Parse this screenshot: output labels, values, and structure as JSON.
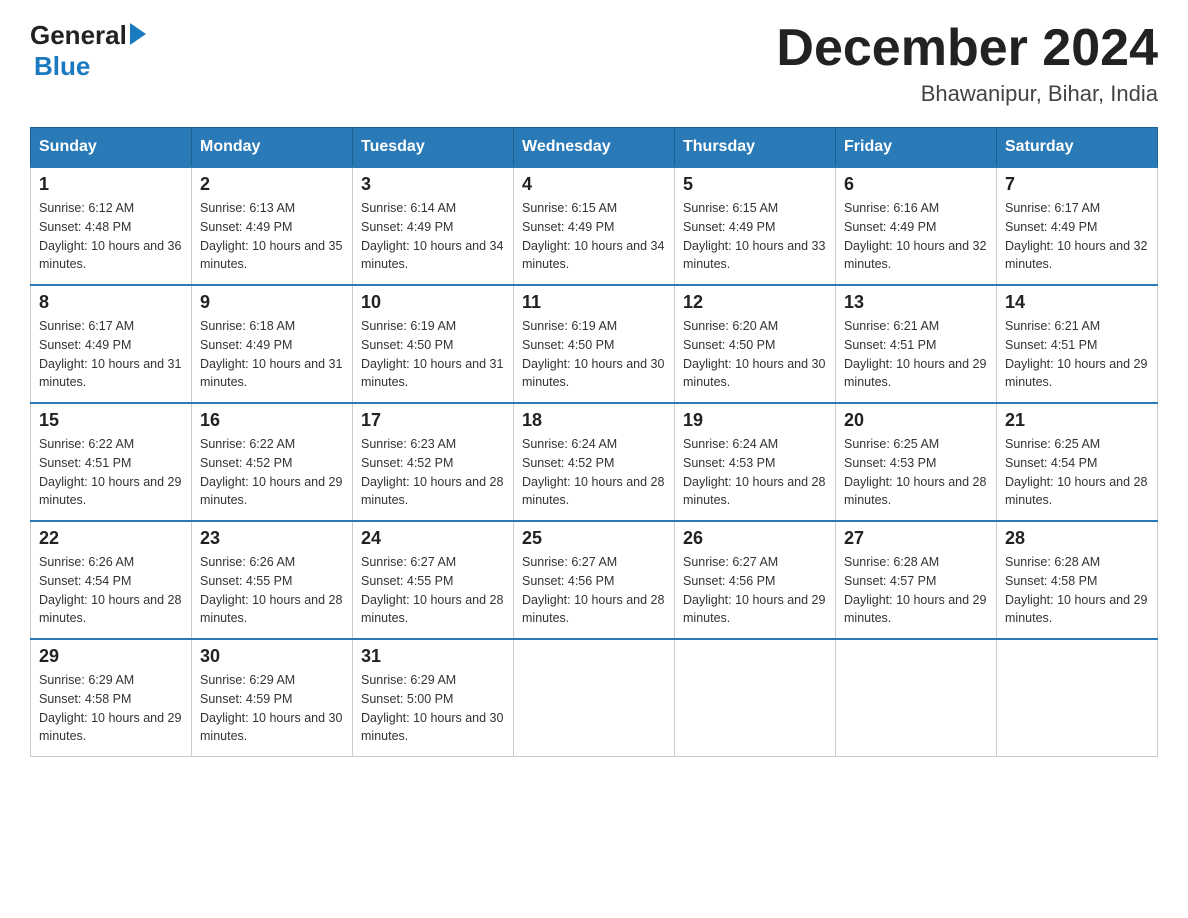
{
  "header": {
    "logo_general": "General",
    "logo_blue": "Blue",
    "month_title": "December 2024",
    "location": "Bhawanipur, Bihar, India"
  },
  "weekdays": [
    "Sunday",
    "Monday",
    "Tuesday",
    "Wednesday",
    "Thursday",
    "Friday",
    "Saturday"
  ],
  "weeks": [
    {
      "days": [
        {
          "number": "1",
          "sunrise": "Sunrise: 6:12 AM",
          "sunset": "Sunset: 4:48 PM",
          "daylight": "Daylight: 10 hours and 36 minutes."
        },
        {
          "number": "2",
          "sunrise": "Sunrise: 6:13 AM",
          "sunset": "Sunset: 4:49 PM",
          "daylight": "Daylight: 10 hours and 35 minutes."
        },
        {
          "number": "3",
          "sunrise": "Sunrise: 6:14 AM",
          "sunset": "Sunset: 4:49 PM",
          "daylight": "Daylight: 10 hours and 34 minutes."
        },
        {
          "number": "4",
          "sunrise": "Sunrise: 6:15 AM",
          "sunset": "Sunset: 4:49 PM",
          "daylight": "Daylight: 10 hours and 34 minutes."
        },
        {
          "number": "5",
          "sunrise": "Sunrise: 6:15 AM",
          "sunset": "Sunset: 4:49 PM",
          "daylight": "Daylight: 10 hours and 33 minutes."
        },
        {
          "number": "6",
          "sunrise": "Sunrise: 6:16 AM",
          "sunset": "Sunset: 4:49 PM",
          "daylight": "Daylight: 10 hours and 32 minutes."
        },
        {
          "number": "7",
          "sunrise": "Sunrise: 6:17 AM",
          "sunset": "Sunset: 4:49 PM",
          "daylight": "Daylight: 10 hours and 32 minutes."
        }
      ]
    },
    {
      "days": [
        {
          "number": "8",
          "sunrise": "Sunrise: 6:17 AM",
          "sunset": "Sunset: 4:49 PM",
          "daylight": "Daylight: 10 hours and 31 minutes."
        },
        {
          "number": "9",
          "sunrise": "Sunrise: 6:18 AM",
          "sunset": "Sunset: 4:49 PM",
          "daylight": "Daylight: 10 hours and 31 minutes."
        },
        {
          "number": "10",
          "sunrise": "Sunrise: 6:19 AM",
          "sunset": "Sunset: 4:50 PM",
          "daylight": "Daylight: 10 hours and 31 minutes."
        },
        {
          "number": "11",
          "sunrise": "Sunrise: 6:19 AM",
          "sunset": "Sunset: 4:50 PM",
          "daylight": "Daylight: 10 hours and 30 minutes."
        },
        {
          "number": "12",
          "sunrise": "Sunrise: 6:20 AM",
          "sunset": "Sunset: 4:50 PM",
          "daylight": "Daylight: 10 hours and 30 minutes."
        },
        {
          "number": "13",
          "sunrise": "Sunrise: 6:21 AM",
          "sunset": "Sunset: 4:51 PM",
          "daylight": "Daylight: 10 hours and 29 minutes."
        },
        {
          "number": "14",
          "sunrise": "Sunrise: 6:21 AM",
          "sunset": "Sunset: 4:51 PM",
          "daylight": "Daylight: 10 hours and 29 minutes."
        }
      ]
    },
    {
      "days": [
        {
          "number": "15",
          "sunrise": "Sunrise: 6:22 AM",
          "sunset": "Sunset: 4:51 PM",
          "daylight": "Daylight: 10 hours and 29 minutes."
        },
        {
          "number": "16",
          "sunrise": "Sunrise: 6:22 AM",
          "sunset": "Sunset: 4:52 PM",
          "daylight": "Daylight: 10 hours and 29 minutes."
        },
        {
          "number": "17",
          "sunrise": "Sunrise: 6:23 AM",
          "sunset": "Sunset: 4:52 PM",
          "daylight": "Daylight: 10 hours and 28 minutes."
        },
        {
          "number": "18",
          "sunrise": "Sunrise: 6:24 AM",
          "sunset": "Sunset: 4:52 PM",
          "daylight": "Daylight: 10 hours and 28 minutes."
        },
        {
          "number": "19",
          "sunrise": "Sunrise: 6:24 AM",
          "sunset": "Sunset: 4:53 PM",
          "daylight": "Daylight: 10 hours and 28 minutes."
        },
        {
          "number": "20",
          "sunrise": "Sunrise: 6:25 AM",
          "sunset": "Sunset: 4:53 PM",
          "daylight": "Daylight: 10 hours and 28 minutes."
        },
        {
          "number": "21",
          "sunrise": "Sunrise: 6:25 AM",
          "sunset": "Sunset: 4:54 PM",
          "daylight": "Daylight: 10 hours and 28 minutes."
        }
      ]
    },
    {
      "days": [
        {
          "number": "22",
          "sunrise": "Sunrise: 6:26 AM",
          "sunset": "Sunset: 4:54 PM",
          "daylight": "Daylight: 10 hours and 28 minutes."
        },
        {
          "number": "23",
          "sunrise": "Sunrise: 6:26 AM",
          "sunset": "Sunset: 4:55 PM",
          "daylight": "Daylight: 10 hours and 28 minutes."
        },
        {
          "number": "24",
          "sunrise": "Sunrise: 6:27 AM",
          "sunset": "Sunset: 4:55 PM",
          "daylight": "Daylight: 10 hours and 28 minutes."
        },
        {
          "number": "25",
          "sunrise": "Sunrise: 6:27 AM",
          "sunset": "Sunset: 4:56 PM",
          "daylight": "Daylight: 10 hours and 28 minutes."
        },
        {
          "number": "26",
          "sunrise": "Sunrise: 6:27 AM",
          "sunset": "Sunset: 4:56 PM",
          "daylight": "Daylight: 10 hours and 29 minutes."
        },
        {
          "number": "27",
          "sunrise": "Sunrise: 6:28 AM",
          "sunset": "Sunset: 4:57 PM",
          "daylight": "Daylight: 10 hours and 29 minutes."
        },
        {
          "number": "28",
          "sunrise": "Sunrise: 6:28 AM",
          "sunset": "Sunset: 4:58 PM",
          "daylight": "Daylight: 10 hours and 29 minutes."
        }
      ]
    },
    {
      "days": [
        {
          "number": "29",
          "sunrise": "Sunrise: 6:29 AM",
          "sunset": "Sunset: 4:58 PM",
          "daylight": "Daylight: 10 hours and 29 minutes."
        },
        {
          "number": "30",
          "sunrise": "Sunrise: 6:29 AM",
          "sunset": "Sunset: 4:59 PM",
          "daylight": "Daylight: 10 hours and 30 minutes."
        },
        {
          "number": "31",
          "sunrise": "Sunrise: 6:29 AM",
          "sunset": "Sunset: 5:00 PM",
          "daylight": "Daylight: 10 hours and 30 minutes."
        },
        null,
        null,
        null,
        null
      ]
    }
  ]
}
